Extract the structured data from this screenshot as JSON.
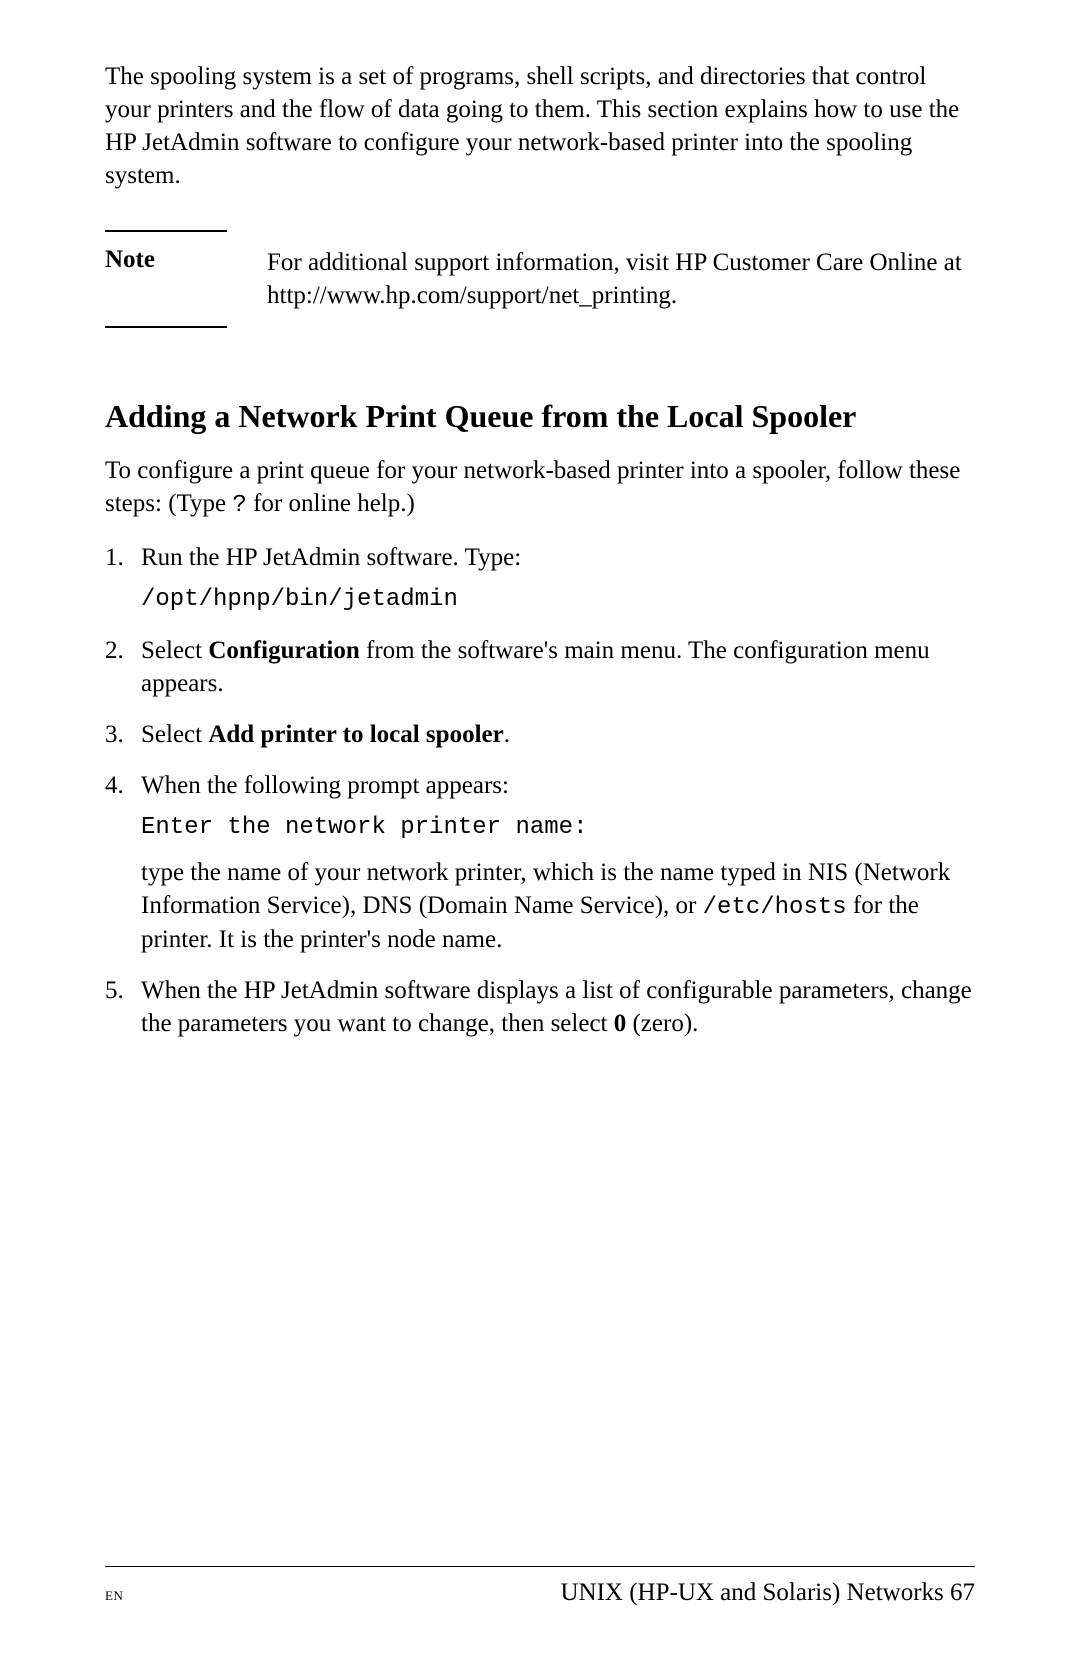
{
  "intro": "The spooling system is a set of programs, shell scripts, and directories that control your printers and the flow of data going to them. This section explains how to use the HP JetAdmin software to configure your network-based printer into the spooling system.",
  "note": {
    "label": "Note",
    "text": "For additional support information, visit HP Customer Care Online at http://www.hp.com/support/net_printing."
  },
  "section": {
    "heading": "Adding a Network Print Queue from the Local Spooler",
    "intro_before": "To configure a print queue for your network-based printer into a spooler, follow these steps: (Type ",
    "intro_mono": "?",
    "intro_after": " for online help.)"
  },
  "steps": {
    "s1": {
      "text": "Run the HP JetAdmin software. Type:",
      "code": "/opt/hpnp/bin/jetadmin"
    },
    "s2": {
      "before": "Select ",
      "bold": "Configuration",
      "after": " from the software's main menu. The configuration menu appears."
    },
    "s3": {
      "before": "Select ",
      "bold": "Add printer to local spooler",
      "after": "."
    },
    "s4": {
      "text": "When the following prompt appears:",
      "code": "Enter the network printer name:",
      "follow_a": "type the name of your network printer, which is the name typed in NIS (Network Information Service), DNS (Domain Name Service), or ",
      "follow_mono": "/etc/hosts",
      "follow_b": " for the printer. It is the printer's node name."
    },
    "s5": {
      "before": "When the HP JetAdmin software displays a list of configurable parameters, change the parameters you want to change, then select ",
      "bold": "0",
      "after": " (zero)."
    }
  },
  "footer": {
    "left": "EN",
    "right": "UNIX (HP-UX and Solaris) Networks 67"
  }
}
